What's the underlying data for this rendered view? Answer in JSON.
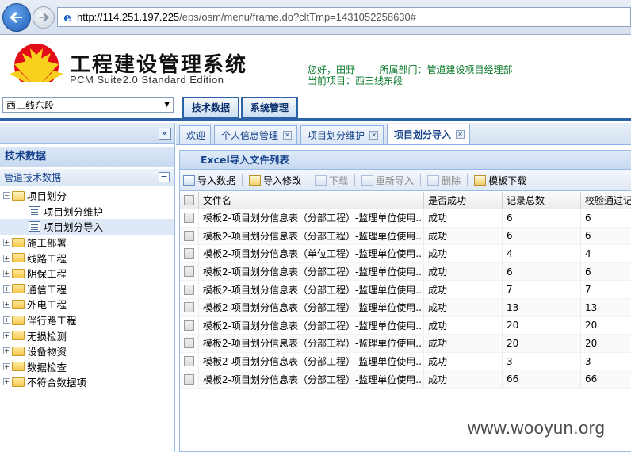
{
  "browser": {
    "url_host": "http://114.251.197.225",
    "url_rest": "/eps/osm/menu/frame.do?cltTmp=1431052258630#"
  },
  "header": {
    "app_title": "工程建设管理系统",
    "app_subtitle": "PCM Suite2.0 Standard Edition",
    "greeting": "您好，田野",
    "dept_label": "所属部门：",
    "dept_value": "管道建设项目经理部",
    "project_label": "当前项目：",
    "project_value": "西三线东段",
    "project_select": "西三线东段",
    "nav_tabs": [
      "技术数据",
      "系统管理"
    ]
  },
  "sidebar": {
    "collapse_glyph": "«",
    "section_title": "技术数据",
    "panel_title": "管道技术数据",
    "tree": [
      {
        "label": "项目划分",
        "type": "folder",
        "expanded": true,
        "level": 0
      },
      {
        "label": "项目划分维护",
        "type": "leaf",
        "level": 1
      },
      {
        "label": "项目划分导入",
        "type": "leaf",
        "level": 1,
        "selected": true
      },
      {
        "label": "施工部署",
        "type": "folder",
        "level": 0
      },
      {
        "label": "线路工程",
        "type": "folder",
        "level": 0
      },
      {
        "label": "阴保工程",
        "type": "folder",
        "level": 0
      },
      {
        "label": "通信工程",
        "type": "folder",
        "level": 0
      },
      {
        "label": "外电工程",
        "type": "folder",
        "level": 0
      },
      {
        "label": "伴行路工程",
        "type": "folder",
        "level": 0
      },
      {
        "label": "无损检测",
        "type": "folder",
        "level": 0
      },
      {
        "label": "设备物资",
        "type": "folder",
        "level": 0
      },
      {
        "label": "数据检查",
        "type": "folder",
        "level": 0
      },
      {
        "label": "不符合数据项",
        "type": "folder",
        "level": 0
      }
    ]
  },
  "main": {
    "tabs": [
      {
        "label": "欢迎",
        "closable": false
      },
      {
        "label": "个人信息管理",
        "closable": true
      },
      {
        "label": "项目划分维护",
        "closable": true
      },
      {
        "label": "项目划分导入",
        "closable": true,
        "active": true
      }
    ],
    "list_title": "Excel导入文件列表",
    "toolbar": [
      {
        "label": "导入数据",
        "enabled": true,
        "icon": "import-icon"
      },
      {
        "label": "导入修改",
        "enabled": true,
        "icon": "edit-import-icon"
      },
      {
        "label": "下载",
        "enabled": false,
        "icon": "download-icon"
      },
      {
        "label": "重新导入",
        "enabled": false,
        "icon": "reimport-icon"
      },
      {
        "label": "删除",
        "enabled": false,
        "icon": "delete-icon"
      },
      {
        "label": "模板下载",
        "enabled": true,
        "icon": "template-download-icon"
      }
    ],
    "columns": [
      "文件名",
      "是否成功",
      "记录总数",
      "校验通过记"
    ],
    "rows": [
      {
        "file": "模板2-项目划分信息表（分部工程）-监理单位使用...",
        "success": "成功",
        "total": "6",
        "passed": "6"
      },
      {
        "file": "模板2-项目划分信息表（分部工程）-监理单位使用...",
        "success": "成功",
        "total": "6",
        "passed": "6"
      },
      {
        "file": "模板2-项目划分信息表（单位工程）-监理单位使用...",
        "success": "成功",
        "total": "4",
        "passed": "4"
      },
      {
        "file": "模板2-项目划分信息表（分部工程）-监理单位使用...",
        "success": "成功",
        "total": "6",
        "passed": "6"
      },
      {
        "file": "模板2-项目划分信息表（分部工程）-监理单位使用...",
        "success": "成功",
        "total": "7",
        "passed": "7"
      },
      {
        "file": "模板2-项目划分信息表（分部工程）-监理单位使用...",
        "success": "成功",
        "total": "13",
        "passed": "13"
      },
      {
        "file": "模板2-项目划分信息表（分部工程）-监理单位使用...",
        "success": "成功",
        "total": "20",
        "passed": "20"
      },
      {
        "file": "模板2-项目划分信息表（分部工程）-监理单位使用...",
        "success": "成功",
        "total": "20",
        "passed": "20"
      },
      {
        "file": "模板2-项目划分信息表（分部工程）-监理单位使用...",
        "success": "成功",
        "total": "3",
        "passed": "3"
      },
      {
        "file": "模板2-项目划分信息表（分部工程）-监理单位使用...",
        "success": "成功",
        "total": "66",
        "passed": "66"
      }
    ]
  },
  "watermark": "www.wooyun.org",
  "colors": {
    "accent": "#2b63a8",
    "header_text": "#15428b",
    "user_info": "#0a7a2a"
  }
}
